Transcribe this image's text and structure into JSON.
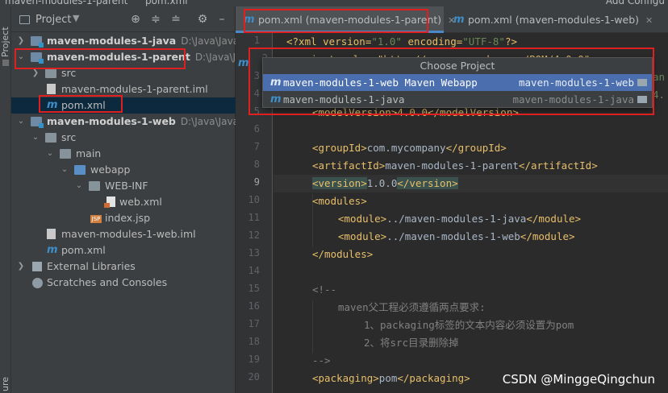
{
  "topbar": {
    "crumb_a": "maven-modules-1-parent",
    "crumb_b": "pom.xml",
    "config": "Add Configu"
  },
  "strip": {
    "label": "Project",
    "bottom_label": "ure"
  },
  "project_panel": {
    "title": "Project",
    "tree": [
      {
        "label": "maven-modules-1-java",
        "path": "D:\\Java\\JavaPro",
        "bold": true,
        "icon": "module-icon"
      },
      {
        "label": "maven-modules-1-parent",
        "path": "D:\\Java\\JavaPro",
        "bold": true,
        "icon": "module-icon"
      },
      {
        "label": "src",
        "icon": "folder-icon"
      },
      {
        "label": "maven-modules-1-parent.iml",
        "icon": "file-icon"
      },
      {
        "label": "pom.xml",
        "icon": "maven-icon"
      },
      {
        "label": "maven-modules-1-web",
        "path": "D:\\Java\\JavaPro",
        "bold": true,
        "icon": "module-icon"
      },
      {
        "label": "src",
        "icon": "folder-icon"
      },
      {
        "label": "main",
        "icon": "folder-icon"
      },
      {
        "label": "webapp",
        "icon": "folder-icon"
      },
      {
        "label": "WEB-INF",
        "icon": "folder-icon"
      },
      {
        "label": "web.xml",
        "icon": "xml-icon"
      },
      {
        "label": "index.jsp",
        "icon": "jsp-icon"
      },
      {
        "label": "maven-modules-1-web.iml",
        "icon": "file-icon"
      },
      {
        "label": "pom.xml",
        "icon": "maven-icon"
      },
      {
        "label": "External Libraries",
        "icon": "library-icon"
      },
      {
        "label": "Scratches and Consoles",
        "icon": "scratch-icon"
      }
    ]
  },
  "tabs": [
    {
      "label": "pom.xml (maven-modules-1-parent)",
      "active": true
    },
    {
      "label": "pom.xml (maven-modules-1-web)",
      "active": false
    }
  ],
  "gutter": {
    "lines": [
      "1",
      "2",
      "3",
      "4",
      "5",
      "6",
      "7",
      "8",
      "9",
      "10",
      "11",
      "12",
      "13",
      "14",
      "15",
      "16",
      "17",
      "18",
      "19",
      "20"
    ]
  },
  "code": {
    "l1_decl_a": "<?xml version=",
    "l1_decl_v1": "\"1.0\"",
    "l1_decl_b": " encoding=",
    "l1_decl_v2": "\"UTF-8\"",
    "l1_decl_c": "?>",
    "l2_frag": "<project xmlns=\"http://maven.apache.org/POM/4.0.0\"",
    "l3_frag": "an",
    "l4_frag": "4.",
    "l5": "<modelVersion>4.0.0</modelVersion>",
    "l7_open": "<groupId>",
    "l7_val": "com.mycompany",
    "l7_close": "</groupId>",
    "l8_open": "<artifactId>",
    "l8_val": "maven-modules-1-parent",
    "l8_close": "</artifactId>",
    "l9_open": "<version>",
    "l9_val": "1.0.0",
    "l9_close": "</version>",
    "l10": "<modules>",
    "l11_open": "<module>",
    "l11_val": "../maven-modules-1-java",
    "l11_close": "</module>",
    "l12_open": "<module>",
    "l12_val": "../maven-modules-1-web",
    "l12_close": "</module>",
    "l13": "</modules>",
    "l15": "<!--",
    "l16": "maven父工程必须遵循两点要求:",
    "l17": "1、packaging标签的文本内容必须设置为pom",
    "l18": "2、将src目录删除掉",
    "l19": "-->",
    "l20_open": "<packaging>",
    "l20_val": "pom",
    "l20_close": "</packaging>"
  },
  "popup": {
    "title": "Choose Project",
    "items": [
      {
        "name": "maven-modules-1-web Maven Webapp",
        "right": "maven-modules-1-web",
        "selected": true
      },
      {
        "name": "maven-modules-1-java",
        "right": "maven-modules-1-java",
        "selected": false
      }
    ]
  },
  "watermark": "CSDN @MinggeQingchun",
  "colors": {
    "accent": "#4b6eaf",
    "annotation": "#e02020",
    "tag": "#e8bf6a",
    "string": "#6a8759"
  }
}
